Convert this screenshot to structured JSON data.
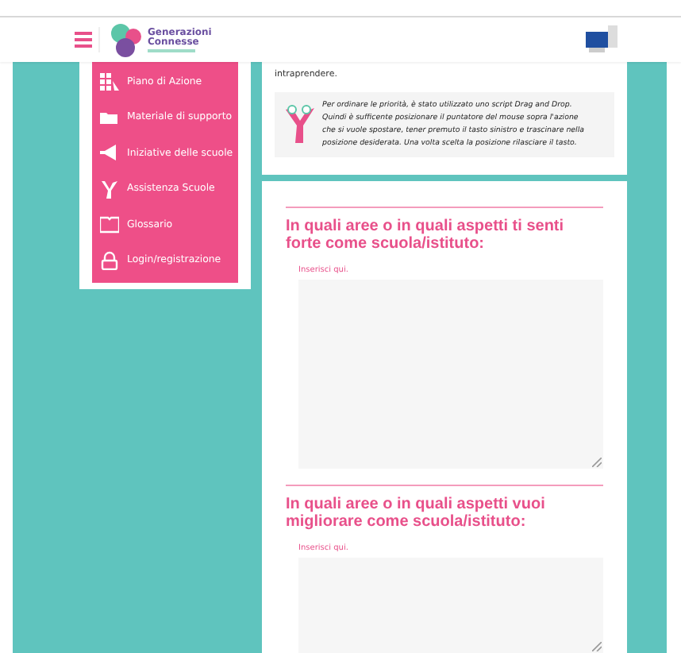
{
  "header": {
    "logo": {
      "line1": "Generazioni",
      "line2": "Connesse"
    }
  },
  "menu": [
    {
      "label": "Piano di Azione",
      "kind": "grid"
    },
    {
      "label": "Materiale di supporto",
      "kind": "folder"
    },
    {
      "label": "Iniziative delle scuole",
      "kind": "megaphone"
    },
    {
      "label": "Assistenza Scuole",
      "kind": "mascot"
    },
    {
      "label": "Glossario",
      "kind": "book"
    },
    {
      "label": "Login/registrazione",
      "kind": "lock"
    }
  ],
  "intro": {
    "text": "intraprendere."
  },
  "note": {
    "text": "Per ordinare le priorità, è stato utilizzato uno script Drag and Drop. Quindi è sufficente posizionare il puntatore del mouse sopra l'azione che si vuole spostare, tener premuto il tasto sinistro e trascinare nella posizione desiderata. Una volta scelta la posizione rilasciare il tasto."
  },
  "questions": [
    {
      "title": "In quali aree o in quali aspetti ti senti forte come scuola/istituto:",
      "label": "Inserisci qui."
    },
    {
      "title": "In quali aree o in quali aspetti vuoi migliorare come scuola/istituto:",
      "label": "Inserisci qui."
    }
  ]
}
